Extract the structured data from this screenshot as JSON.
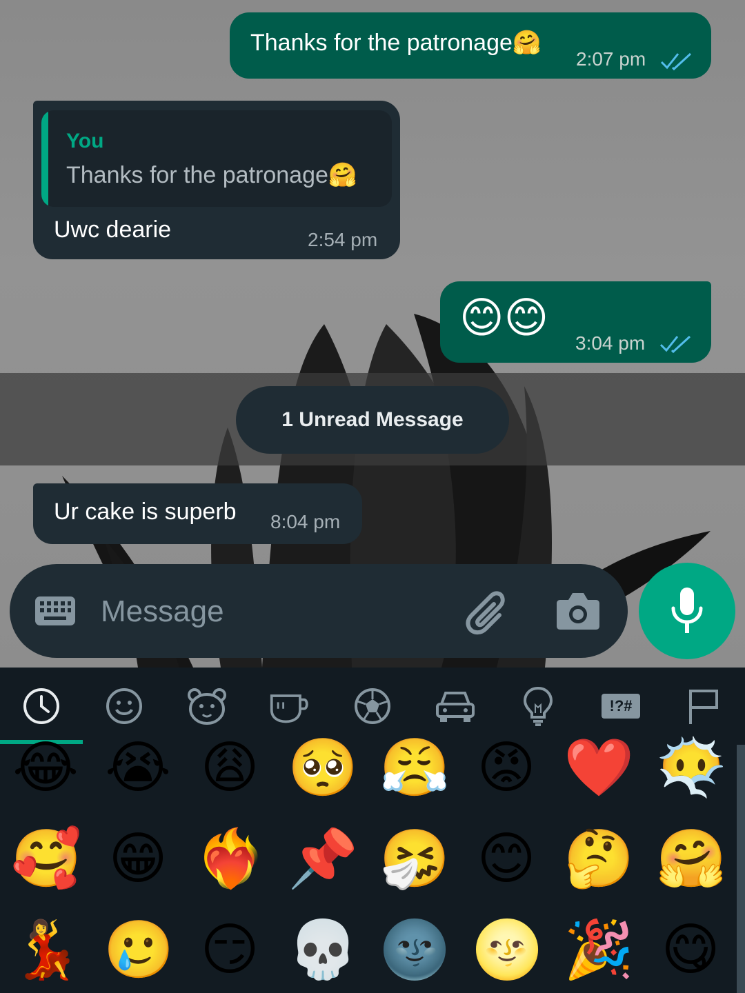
{
  "messages": [
    {
      "direction": "out",
      "text": "Thanks for the patronage🤗",
      "time": "2:07 pm",
      "status": "read"
    },
    {
      "direction": "in",
      "quote": {
        "author": "You",
        "text": "Thanks for the patronage🤗"
      },
      "text": "Uwc dearie",
      "time": "2:54 pm"
    },
    {
      "direction": "out",
      "text": "😊😊",
      "time": "3:04 pm",
      "status": "read"
    },
    {
      "direction": "in",
      "text": "Ur cake is superb",
      "time": "8:04 pm"
    }
  ],
  "unread_banner": "1 Unread Message",
  "composer": {
    "placeholder": "Message"
  },
  "emoji_categories": [
    "recent",
    "smileys",
    "animals",
    "food",
    "activities",
    "travel",
    "objects",
    "symbols",
    "flags"
  ],
  "symbols_label": "!?#",
  "emoji_rows": [
    [
      "😂",
      "😭",
      "😩",
      "🥺",
      "😤",
      "😡",
      "❤️",
      "😶‍🌫️"
    ],
    [
      "🥰",
      "😁",
      "❤️‍🔥",
      "📌",
      "🤧",
      "😊",
      "🤔",
      "🤗"
    ],
    [
      "💃",
      "🥲",
      "😏",
      "💀",
      "🌚",
      "🌝",
      "🎉",
      "😋"
    ]
  ],
  "colors": {
    "outgoing": "#005c4b",
    "incoming": "#1f2c34",
    "accent": "#00a884",
    "read_ticks": "#53bdeb"
  }
}
